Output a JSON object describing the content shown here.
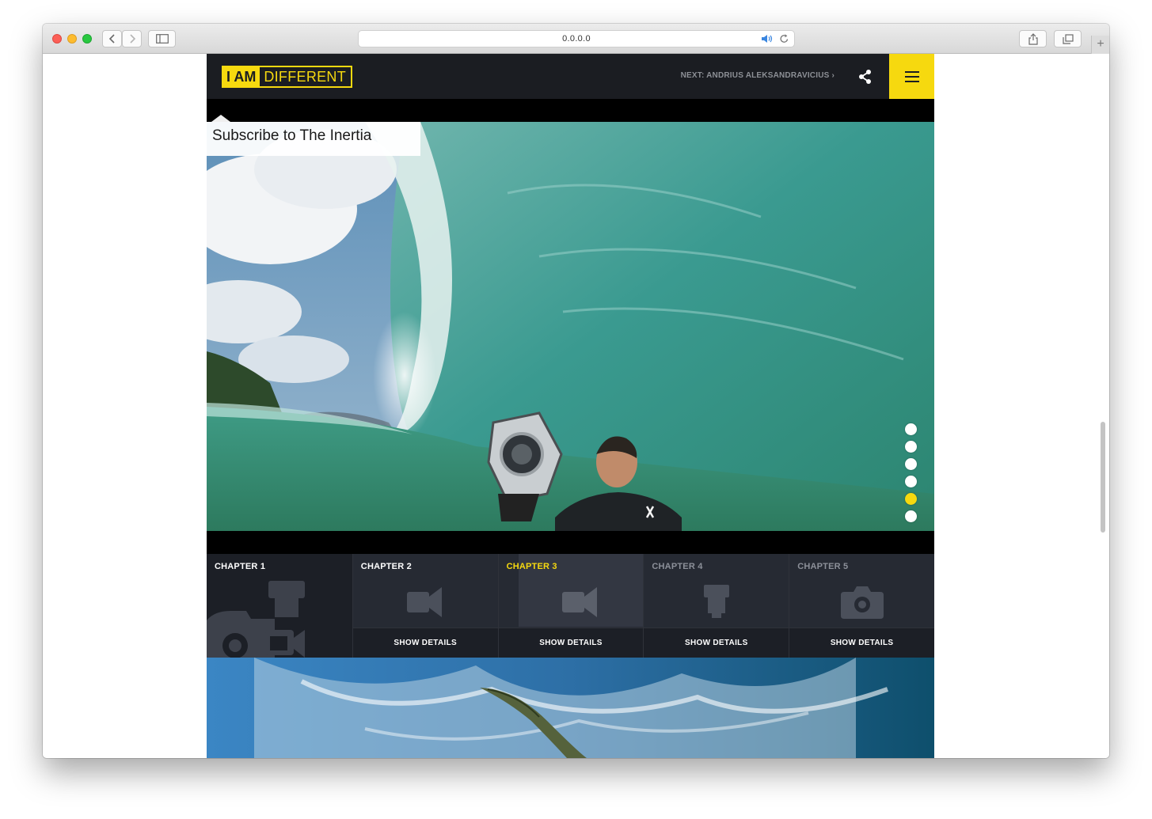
{
  "browser": {
    "url": "0.0.0.0"
  },
  "site": {
    "logo_left": "I AM",
    "logo_right": "DIFFERENT",
    "next_link": "NEXT: ANDRIUS ALEKSANDRAVICIUS ›",
    "accent_color": "#f6d90f",
    "header_color": "#1b1d22"
  },
  "hero": {
    "subscribe_text": "Subscribe to The Inertia",
    "slide_count": 6,
    "active_slide": 5
  },
  "chapters": [
    {
      "label": "CHAPTER 1",
      "icon": "camera-flash-video-icon",
      "details": ""
    },
    {
      "label": "CHAPTER 2",
      "icon": "video-camera-icon",
      "details": "SHOW DETAILS"
    },
    {
      "label": "CHAPTER 3",
      "icon": "video-camera-icon",
      "details": "SHOW DETAILS"
    },
    {
      "label": "CHAPTER 4",
      "icon": "flash-icon",
      "details": "SHOW DETAILS"
    },
    {
      "label": "CHAPTER 5",
      "icon": "camera-icon",
      "details": "SHOW DETAILS"
    }
  ]
}
